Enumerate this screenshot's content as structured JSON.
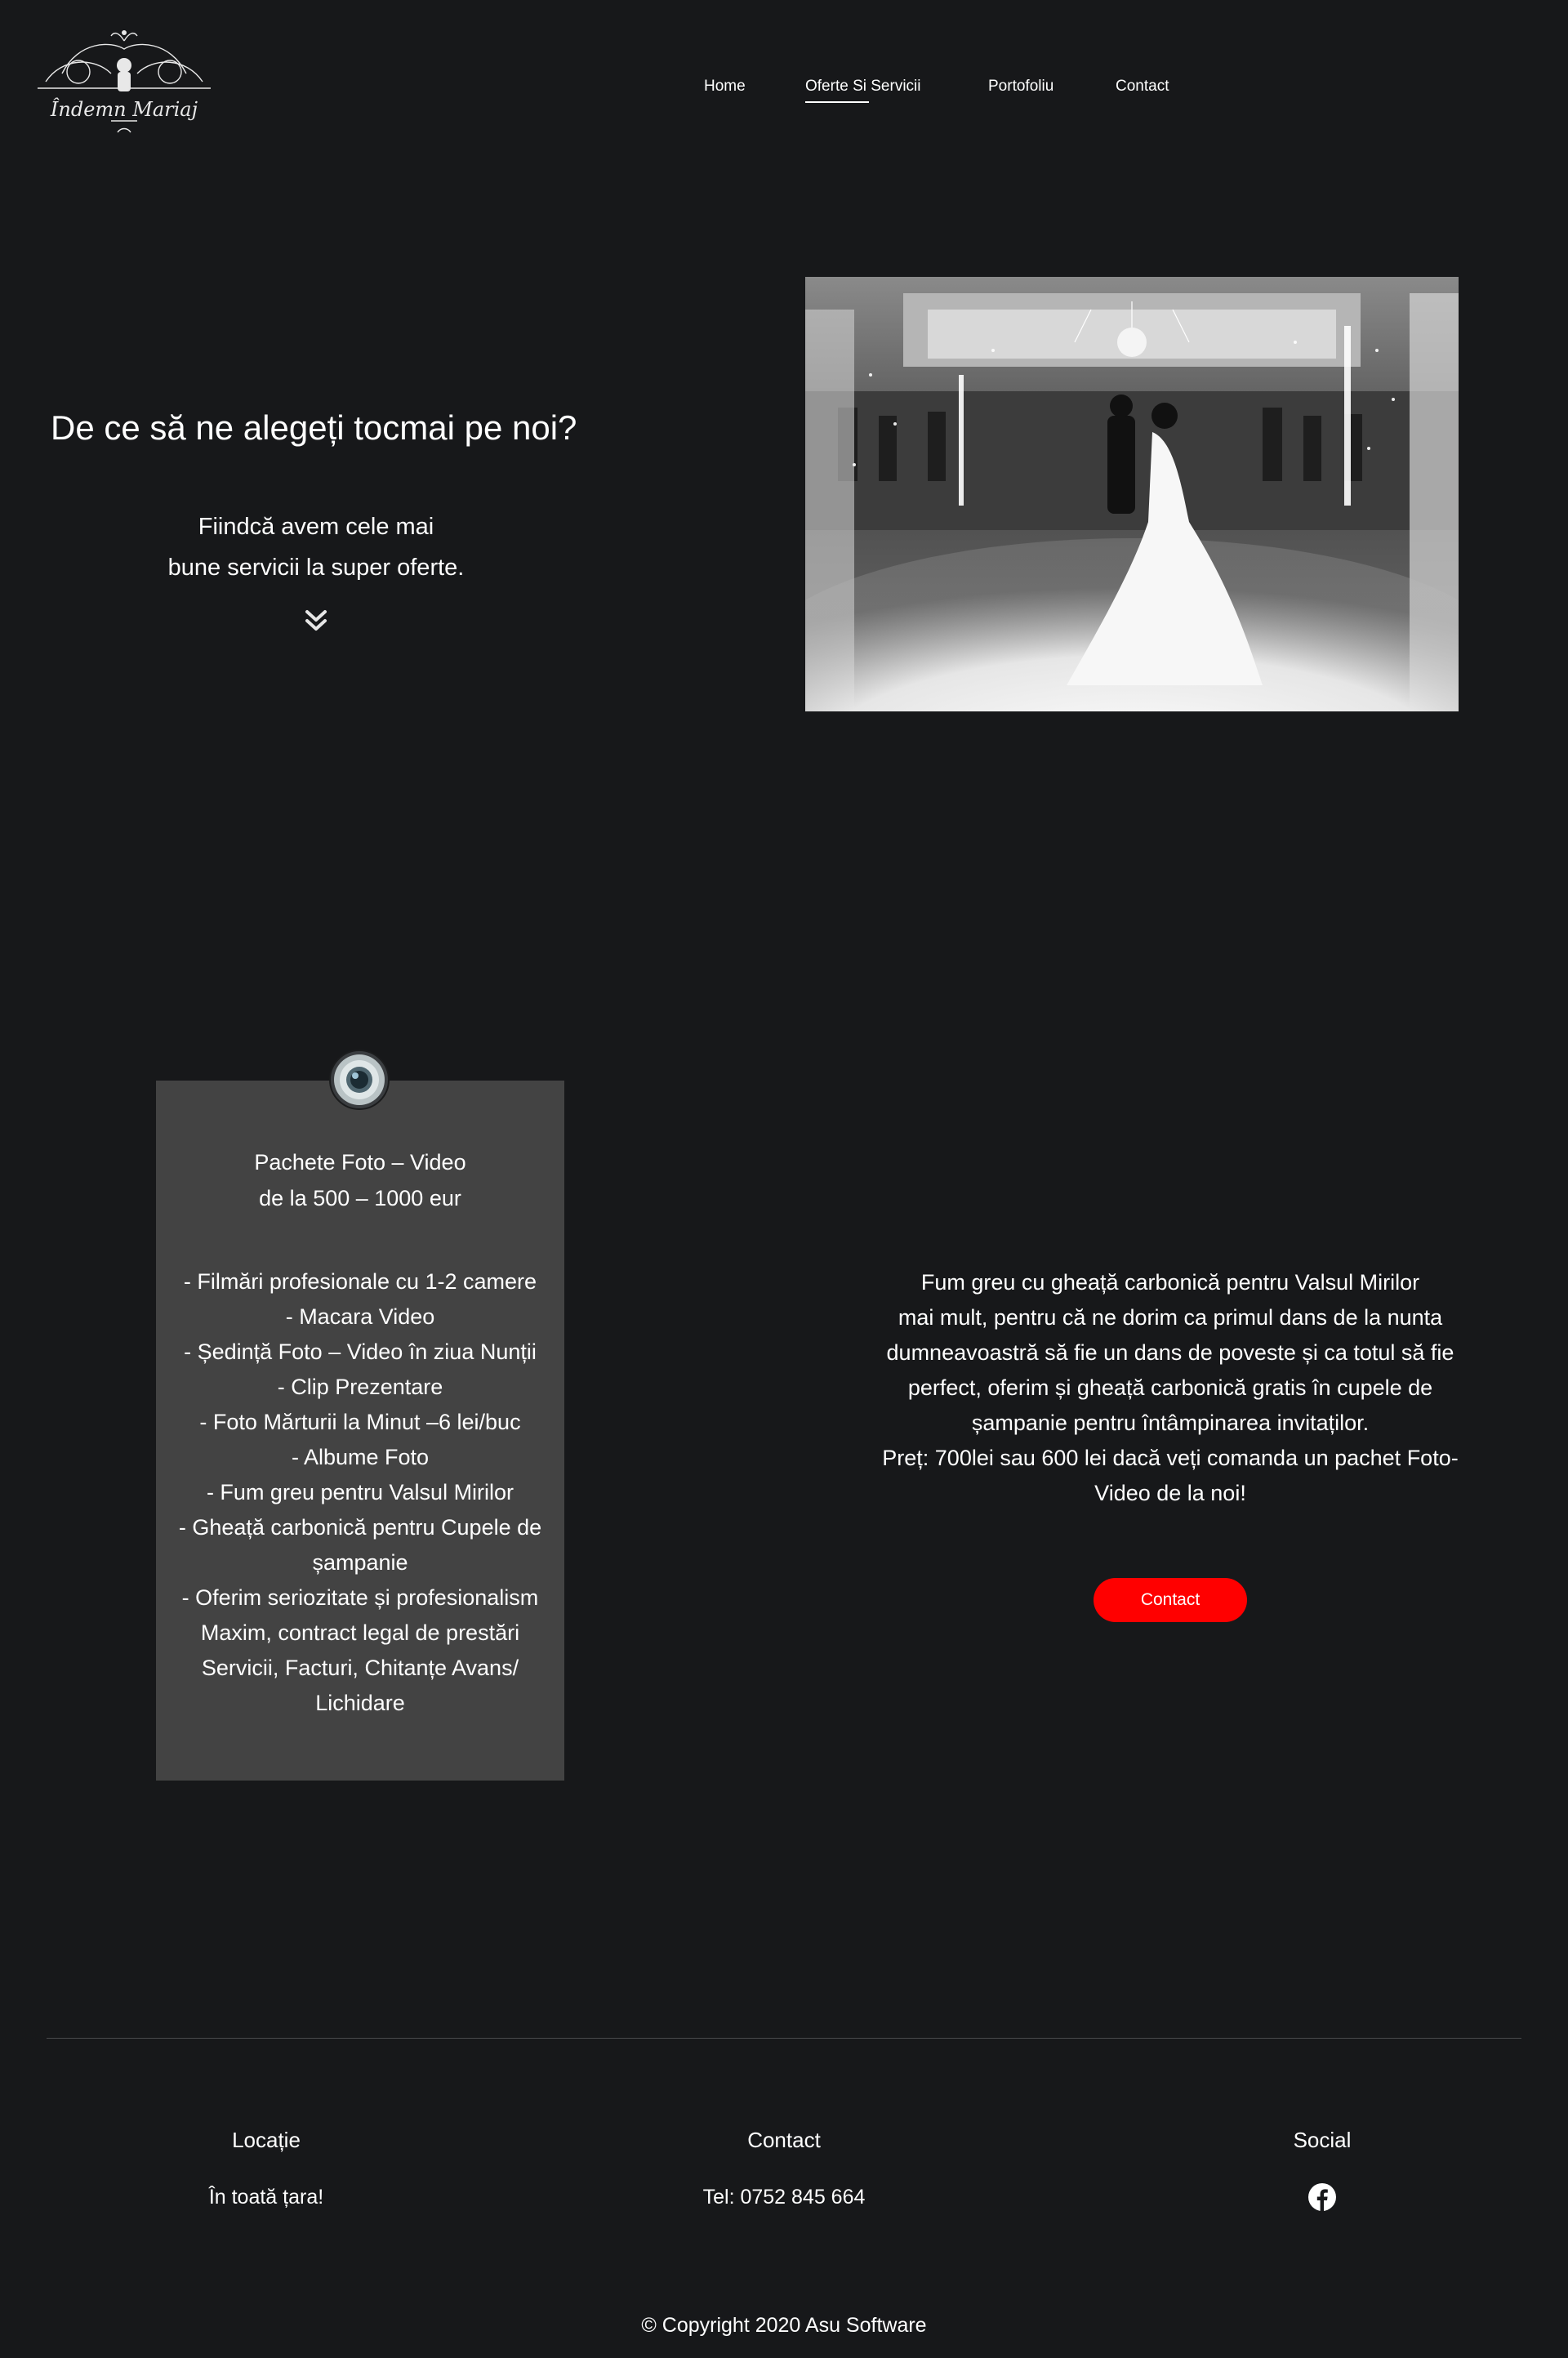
{
  "header": {
    "logo_text": "Îndemn Mariaj",
    "nav": {
      "home": "Home",
      "offers": "Oferte Si Servicii",
      "portfolio": "Portofoliu",
      "contact": "Contact"
    },
    "active_item": "Oferte Si Servicii"
  },
  "hero": {
    "title": "De ce să ne alegeți tocmai pe noi?",
    "subtitle_line1": "Fiindcă avem cele mai",
    "subtitle_line2": "bune servicii la super oferte."
  },
  "package": {
    "title_line1": "Pachete Foto – Video",
    "title_line2": "de la 500 – 1000 eur",
    "items": [
      "- Filmări profesionale cu 1-2 camere",
      "- Macara Video",
      "- Ședință Foto – Video în ziua Nunții",
      "- Clip Prezentare",
      "- Foto Mărturii la Minut –6 lei/buc",
      "- Albume Foto",
      "- Fum greu pentru Valsul Mirilor",
      "- Gheață carbonică pentru Cupele de șampanie",
      "- Oferim seriozitate și profesionalism Maxim, contract legal de prestări Servicii, Facturi, Chitanțe Avans/ Lichidare"
    ]
  },
  "smoke": {
    "line1": "Fum greu cu gheață carbonică  pentru Valsul Mirilor",
    "body": "mai mult, pentru că ne dorim ca primul dans de la nunta dumneavoastră să fie un dans de poveste și ca totul să fie perfect, oferim și gheață carbonică gratis în cupele de șampanie pentru întâmpinarea invitaților.",
    "price": "Preț: 700lei sau 600 lei dacă veți comanda un pachet Foto-Video de la noi!",
    "button": "Contact"
  },
  "footer": {
    "location_title": "Locație",
    "location_value": "În toată țara!",
    "contact_title": "Contact",
    "contact_value": "Tel: 0752 845 664",
    "social_title": "Social",
    "copyright": "© Copyright 2020 Asu Software"
  },
  "colors": {
    "background": "#17181a",
    "card": "#434343",
    "accent": "#ff0000"
  },
  "icons": [
    "logo-emblem",
    "chevron-double-down-icon",
    "camera-lens-icon",
    "facebook-icon"
  ]
}
